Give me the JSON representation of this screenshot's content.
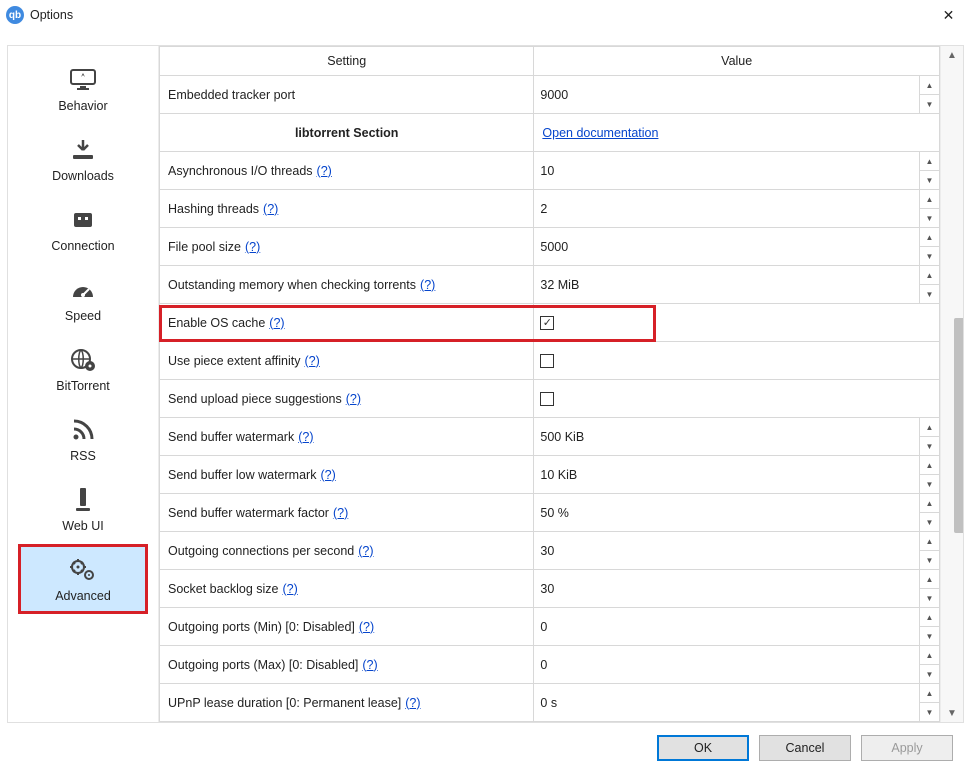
{
  "window": {
    "title": "Options"
  },
  "sidebar": {
    "items": [
      {
        "label": "Behavior",
        "icon": "monitor-icon"
      },
      {
        "label": "Downloads",
        "icon": "download-icon"
      },
      {
        "label": "Connection",
        "icon": "plug-icon"
      },
      {
        "label": "Speed",
        "icon": "gauge-icon"
      },
      {
        "label": "BitTorrent",
        "icon": "globe-gear-icon"
      },
      {
        "label": "RSS",
        "icon": "rss-icon"
      },
      {
        "label": "Web UI",
        "icon": "server-icon"
      },
      {
        "label": "Advanced",
        "icon": "gears-icon"
      }
    ]
  },
  "headers": {
    "setting": "Setting",
    "value": "Value"
  },
  "section": {
    "label": "libtorrent Section",
    "doc": "Open documentation"
  },
  "help": "(?)",
  "rows": {
    "tracker_port": {
      "label": "Embedded tracker port",
      "value": "9000"
    },
    "aio_threads": {
      "label": "Asynchronous I/O threads",
      "value": "10"
    },
    "hash_threads": {
      "label": "Hashing threads",
      "value": "2"
    },
    "file_pool": {
      "label": "File pool size",
      "value": "5000"
    },
    "mem_check": {
      "label": "Outstanding memory when checking torrents",
      "value": "32 MiB"
    },
    "os_cache": {
      "label": "Enable OS cache",
      "checked": true
    },
    "piece_aff": {
      "label": "Use piece extent affinity",
      "checked": false
    },
    "upload_sugg": {
      "label": "Send upload piece suggestions",
      "checked": false
    },
    "buf_wm": {
      "label": "Send buffer watermark",
      "value": "500 KiB"
    },
    "buf_wm_low": {
      "label": "Send buffer low watermark",
      "value": "10 KiB"
    },
    "buf_wm_fac": {
      "label": "Send buffer watermark factor",
      "value": "50 %"
    },
    "out_conn": {
      "label": "Outgoing connections per second",
      "value": "30"
    },
    "sock_bl": {
      "label": "Socket backlog size",
      "value": "30"
    },
    "port_min": {
      "label": "Outgoing ports (Min) [0: Disabled]",
      "value": "0"
    },
    "port_max": {
      "label": "Outgoing ports (Max) [0: Disabled]",
      "value": "0"
    },
    "upnp": {
      "label": "UPnP lease duration [0: Permanent lease]",
      "value": "0 s"
    }
  },
  "footer": {
    "ok": "OK",
    "cancel": "Cancel",
    "apply": "Apply"
  }
}
